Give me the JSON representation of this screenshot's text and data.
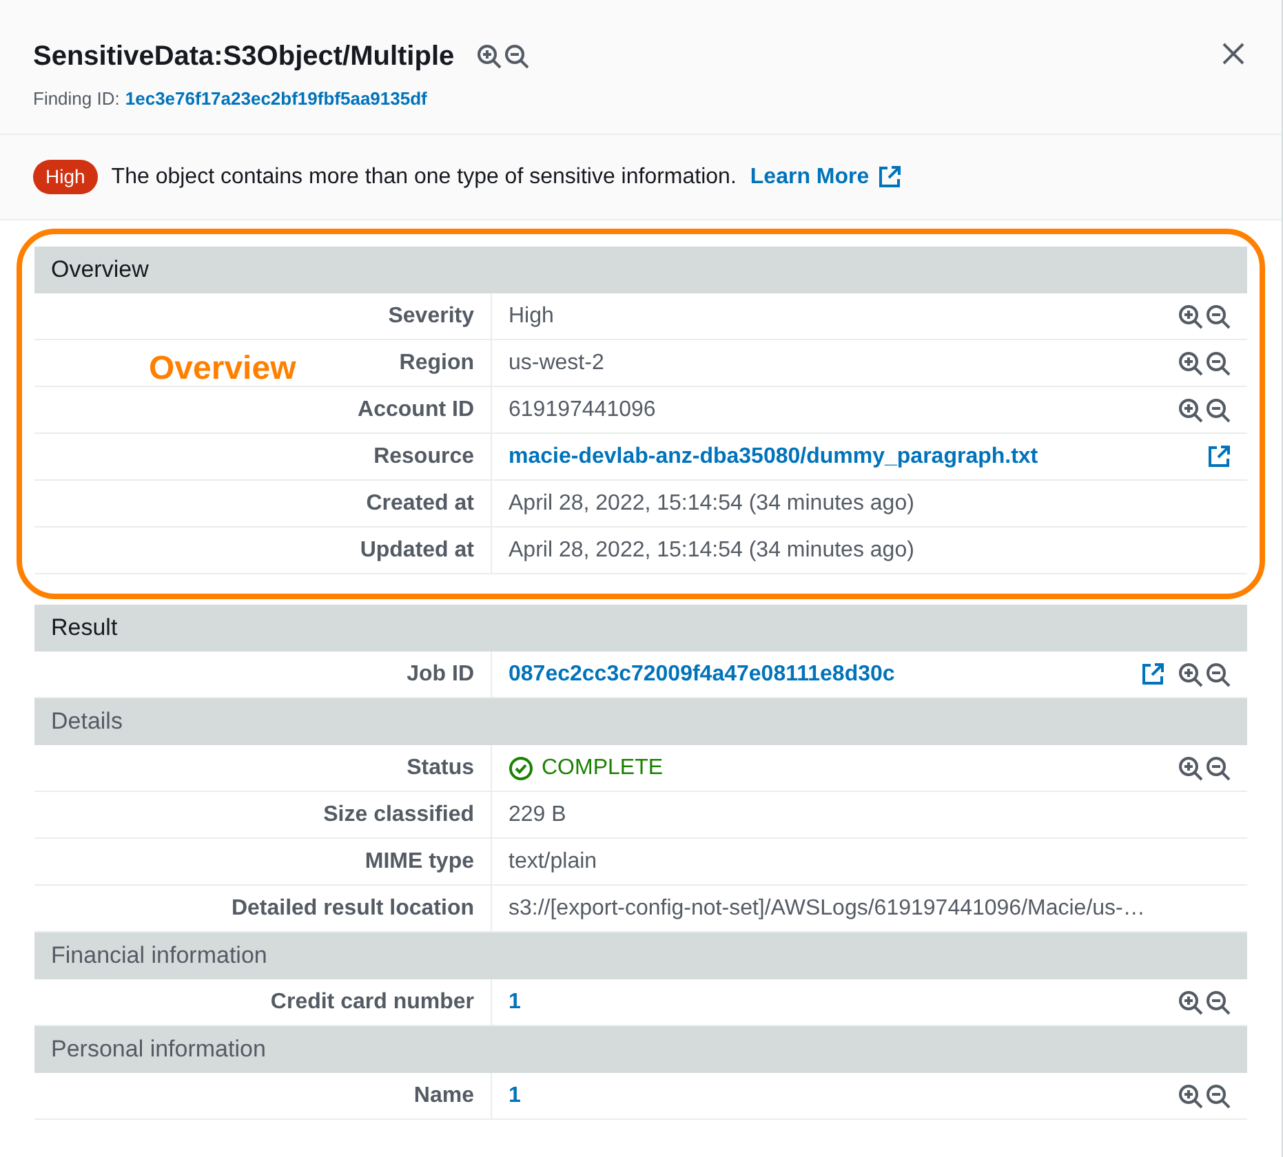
{
  "header": {
    "title": "SensitiveData:S3Object/Multiple",
    "finding_id_label": "Finding ID:",
    "finding_id": "1ec3e76f17a23ec2bf19fbf5aa9135df"
  },
  "banner": {
    "severity": "High",
    "description": "The object contains more than one type of sensitive information.",
    "link": "Learn More"
  },
  "sections": [
    {
      "title": "Overview",
      "kind": "section",
      "highlighted": true,
      "annotation": "Overview",
      "rows": [
        {
          "label": "Severity",
          "value": "High",
          "kind": "text",
          "external_link": false,
          "zoom_controls": true
        },
        {
          "label": "Region",
          "value": "us-west-2",
          "kind": "text",
          "external_link": false,
          "zoom_controls": true
        },
        {
          "label": "Account ID",
          "value": "619197441096",
          "kind": "text",
          "external_link": false,
          "zoom_controls": true
        },
        {
          "label": "Resource",
          "value": "macie-devlab-anz-dba35080/dummy_paragraph.txt",
          "kind": "link",
          "external_link": true,
          "zoom_controls": false
        },
        {
          "label": "Created at",
          "value": "April 28, 2022, 15:14:54 (34 minutes ago)",
          "kind": "text",
          "external_link": false,
          "zoom_controls": false
        },
        {
          "label": "Updated at",
          "value": "April 28, 2022, 15:14:54 (34 minutes ago)",
          "kind": "text",
          "external_link": false,
          "zoom_controls": false
        }
      ]
    },
    {
      "title": "Result",
      "kind": "section",
      "highlighted": false,
      "rows": [
        {
          "label": "Job ID",
          "value": "087ec2cc3c72009f4a47e08111e8d30c",
          "kind": "link",
          "external_link": true,
          "zoom_controls": true
        }
      ]
    },
    {
      "title": "Details",
      "kind": "subsection",
      "highlighted": false,
      "rows": [
        {
          "label": "Status",
          "value": "COMPLETE",
          "kind": "status",
          "external_link": false,
          "zoom_controls": true
        },
        {
          "label": "Size classified",
          "value": "229 B",
          "kind": "text",
          "external_link": false,
          "zoom_controls": false
        },
        {
          "label": "MIME type",
          "value": "text/plain",
          "kind": "text",
          "external_link": false,
          "zoom_controls": false
        },
        {
          "label": "Detailed result location",
          "value": "s3://[export-config-not-set]/AWSLogs/619197441096/Macie/us-…",
          "kind": "text",
          "external_link": false,
          "zoom_controls": false
        }
      ]
    },
    {
      "title": "Financial information",
      "kind": "subsection",
      "highlighted": false,
      "rows": [
        {
          "label": "Credit card number",
          "value": "1",
          "kind": "link",
          "external_link": false,
          "zoom_controls": true
        }
      ]
    },
    {
      "title": "Personal information",
      "kind": "subsection",
      "highlighted": false,
      "rows": [
        {
          "label": "Name",
          "value": "1",
          "kind": "link",
          "external_link": false,
          "zoom_controls": true
        }
      ]
    }
  ]
}
